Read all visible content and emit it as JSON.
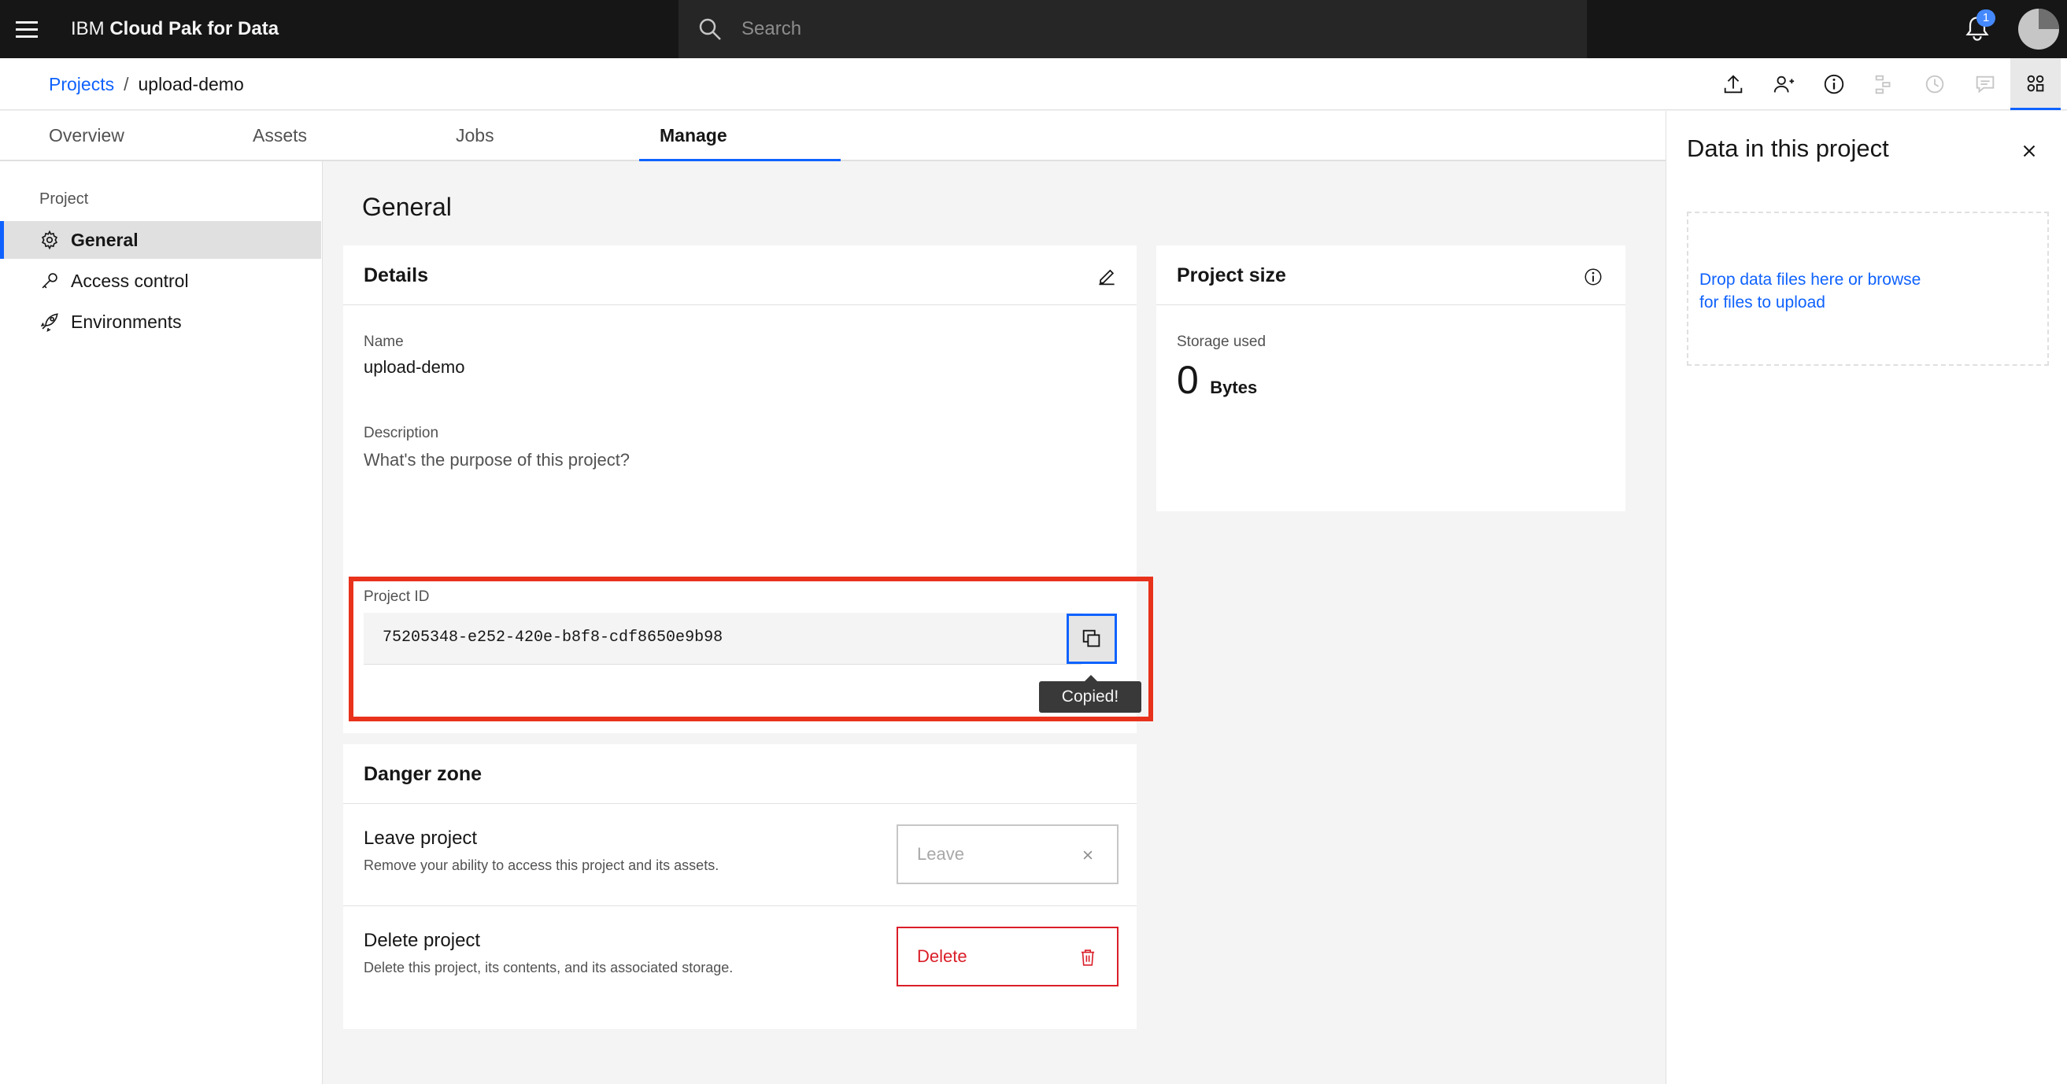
{
  "header": {
    "brand_prefix": "IBM ",
    "brand_name": "Cloud Pak for Data",
    "search_placeholder": "Search",
    "notification_count": "1"
  },
  "breadcrumb": {
    "root": "Projects",
    "separator": "/",
    "current": "upload-demo"
  },
  "toolbar": {
    "icons": [
      "upload-icon",
      "add-collaborator-icon",
      "info-icon",
      "flow-icon",
      "history-icon",
      "comment-icon",
      "data-panel-icon"
    ]
  },
  "tabs": [
    {
      "label": "Overview"
    },
    {
      "label": "Assets"
    },
    {
      "label": "Jobs"
    },
    {
      "label": "Manage",
      "active": true
    }
  ],
  "sidebar": {
    "section": "Project",
    "items": [
      {
        "label": "General",
        "icon": "gear-icon",
        "active": true
      },
      {
        "label": "Access control",
        "icon": "key-icon"
      },
      {
        "label": "Environments",
        "icon": "rocket-icon"
      }
    ]
  },
  "main": {
    "title": "General",
    "details": {
      "title": "Details",
      "name_label": "Name",
      "name_value": "upload-demo",
      "description_label": "Description",
      "description_placeholder": "What's the purpose of this project?",
      "project_id_label": "Project ID",
      "project_id_value": "75205348-e252-420e-b8f8-cdf8650e9b98",
      "copied_tooltip": "Copied!"
    },
    "size": {
      "title": "Project size",
      "storage_label": "Storage used",
      "storage_value": "0",
      "storage_unit": "Bytes"
    },
    "danger_zone": {
      "title": "Danger zone",
      "leave_title": "Leave project",
      "leave_desc": "Remove your ability to access this project and its assets.",
      "leave_button": "Leave",
      "delete_title": "Delete project",
      "delete_desc": "Delete this project, its contents, and its associated storage.",
      "delete_button": "Delete"
    }
  },
  "right_panel": {
    "title": "Data in this project",
    "drop_text": "Drop data files here or browse for files to upload"
  },
  "colors": {
    "accent": "#0f62fe",
    "danger": "#da1e28",
    "highlight": "#e8321c",
    "header_bg": "#161616"
  }
}
